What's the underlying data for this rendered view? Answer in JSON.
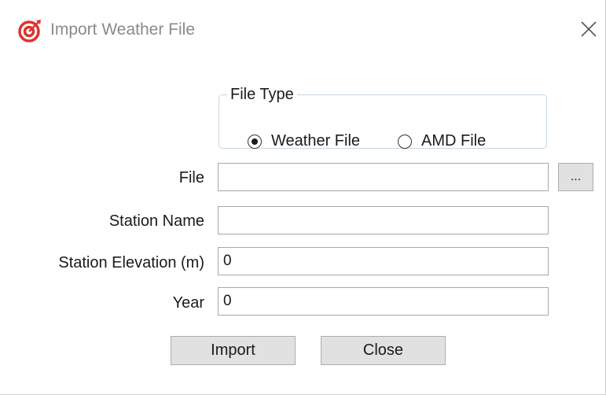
{
  "window": {
    "title": "Import Weather File",
    "accent_color": "#e0322c"
  },
  "file_type": {
    "legend": "File Type",
    "options": [
      {
        "label": "Weather File",
        "checked": true
      },
      {
        "label": "AMD File",
        "checked": false
      }
    ]
  },
  "form": {
    "file": {
      "label": "File",
      "value": ""
    },
    "browse_label": "...",
    "station_name": {
      "label": "Station Name",
      "value": ""
    },
    "station_elevation": {
      "label": "Station Elevation (m)",
      "value": "0"
    },
    "year": {
      "label": "Year",
      "value": "0"
    }
  },
  "buttons": {
    "import_label": "Import",
    "close_label": "Close"
  }
}
